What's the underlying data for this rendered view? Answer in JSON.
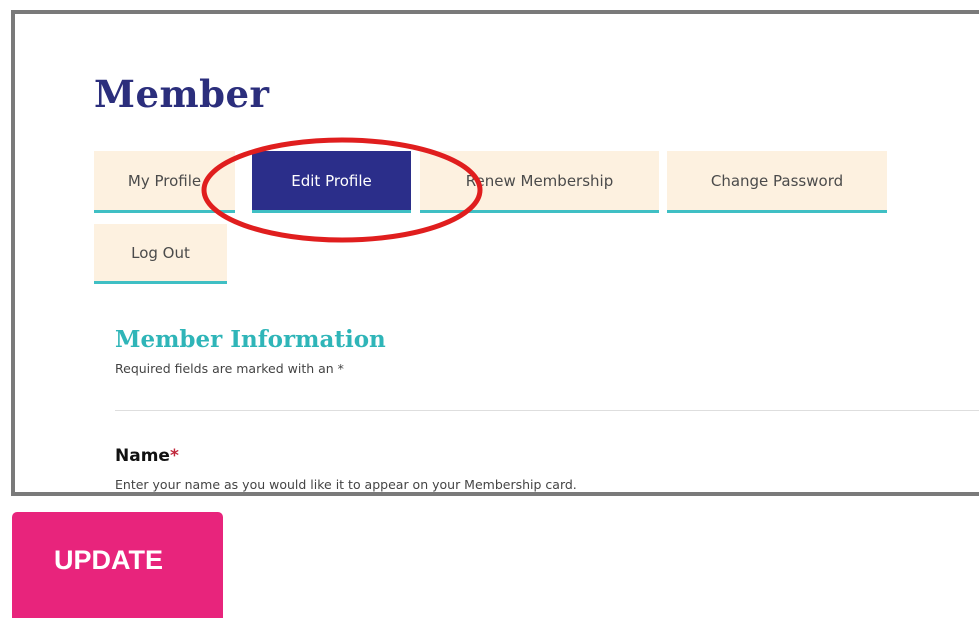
{
  "page": {
    "title": "Member"
  },
  "tabs": [
    {
      "label": "My Profile",
      "active": false
    },
    {
      "label": "Edit Profile",
      "active": true
    },
    {
      "label": "Renew Membership",
      "active": false
    },
    {
      "label": "Change Password",
      "active": false
    },
    {
      "label": "Log Out",
      "active": false
    }
  ],
  "member_information": {
    "title": "Member Information",
    "note": "Required fields are marked with an *"
  },
  "name_field": {
    "label": "Name",
    "required_marker": "*",
    "help": "Enter your name as you would like it to appear on your Membership card."
  },
  "actions": {
    "update_label": "UPDATE"
  },
  "colors": {
    "title": "#2b2e7c",
    "tab_background": "#fdf1e0",
    "tab_active": "#2b2e8a",
    "tab_underline": "#3fbfc4",
    "section_title": "#2fb5b8",
    "required_marker": "#c0263a",
    "update_button": "#e8247c",
    "annotation_ellipse": "#e01e1e"
  }
}
